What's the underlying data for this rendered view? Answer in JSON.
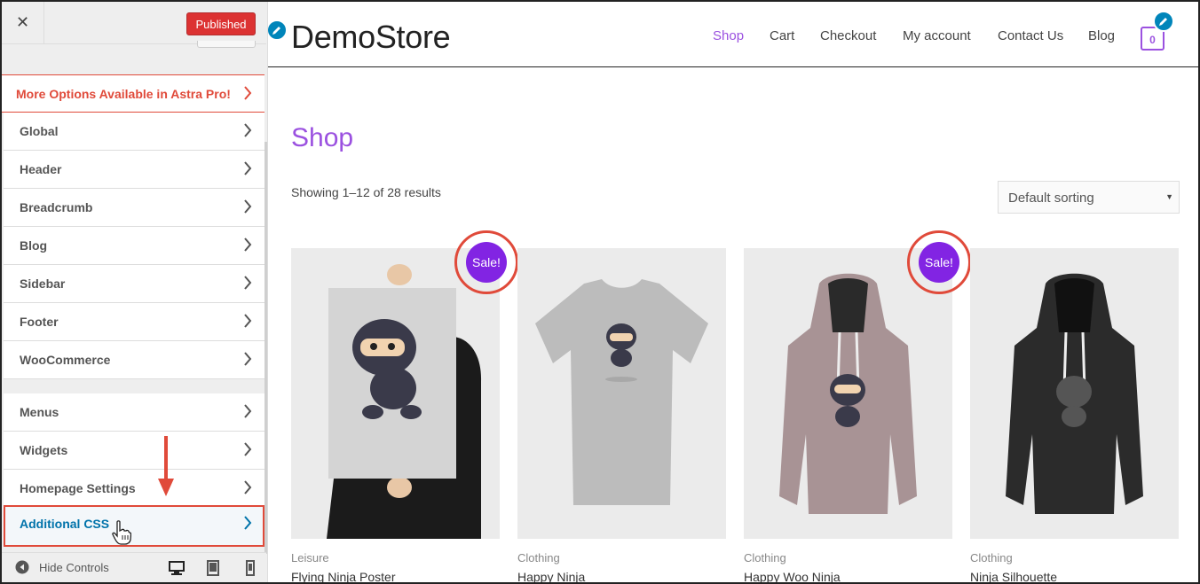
{
  "customizer": {
    "close_symbol": "✕",
    "publish_label": "Published",
    "promo_label": "More Options Available in Astra Pro!",
    "sections_group1": [
      {
        "label": "Global"
      },
      {
        "label": "Header"
      },
      {
        "label": "Breadcrumb"
      },
      {
        "label": "Blog"
      },
      {
        "label": "Sidebar"
      },
      {
        "label": "Footer"
      },
      {
        "label": "WooCommerce"
      }
    ],
    "sections_group2": [
      {
        "label": "Menus"
      },
      {
        "label": "Widgets"
      },
      {
        "label": "Homepage Settings"
      },
      {
        "label": "Additional CSS"
      }
    ],
    "active_section": "Additional CSS",
    "hide_controls_label": "Hide Controls",
    "devices": [
      "desktop-icon",
      "tablet-icon",
      "mobile-icon"
    ],
    "colors": {
      "publish": "#dc3232",
      "highlight": "#e04a3a",
      "active_text": "#0073aa"
    }
  },
  "site": {
    "logo": "DemoStore",
    "nav": [
      {
        "label": "Shop",
        "active": true
      },
      {
        "label": "Cart"
      },
      {
        "label": "Checkout"
      },
      {
        "label": "My account"
      },
      {
        "label": "Contact Us"
      },
      {
        "label": "Blog"
      }
    ],
    "cart_count": "0",
    "page_title": "Shop",
    "results_text": "Showing 1–12 of 28 results",
    "sorting_selected": "Default sorting",
    "sale_badge": "Sale!",
    "products": [
      {
        "category": "Leisure",
        "name": "Flying Ninja Poster",
        "sale": true
      },
      {
        "category": "Clothing",
        "name": "Happy Ninja",
        "sale": false
      },
      {
        "category": "Clothing",
        "name": "Happy Woo Ninja",
        "sale": true
      },
      {
        "category": "Clothing",
        "name": "Ninja Silhouette",
        "sale": false
      }
    ],
    "colors": {
      "accent": "#9b51e0",
      "sale": "#8224e3"
    }
  }
}
